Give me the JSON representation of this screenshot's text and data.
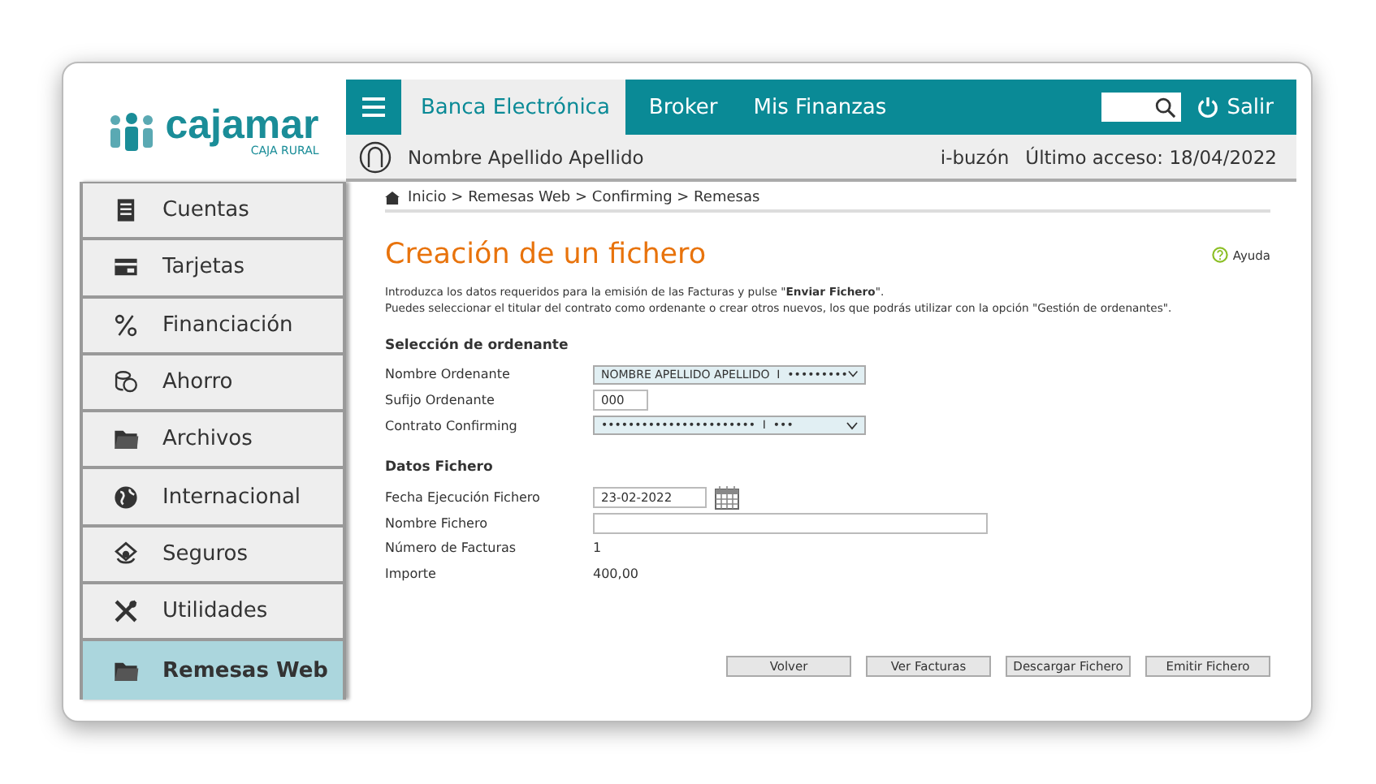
{
  "logo": {
    "name": "cajamar",
    "tagline": "CAJA RURAL"
  },
  "nav": {
    "tabs": [
      {
        "label": "Banca Electrónica",
        "selected": true
      },
      {
        "label": "Broker",
        "selected": false
      },
      {
        "label": "Mis Finanzas",
        "selected": false
      }
    ],
    "logout": "Salir"
  },
  "user": {
    "name": "Nombre Apellido Apellido",
    "mailbox": "i-buzón",
    "last_access": "Último acceso: 18/04/2022"
  },
  "sidebar": {
    "items": [
      {
        "label": "Cuentas",
        "selected": false
      },
      {
        "label": "Tarjetas",
        "selected": false
      },
      {
        "label": "Financiación",
        "selected": false
      },
      {
        "label": "Ahorro",
        "selected": false
      },
      {
        "label": "Archivos",
        "selected": false
      },
      {
        "label": "Internacional",
        "selected": false
      },
      {
        "label": "Seguros",
        "selected": false
      },
      {
        "label": "Utilidades",
        "selected": false
      },
      {
        "label": "Remesas Web",
        "selected": true
      }
    ]
  },
  "breadcrumb": "Inicio > Remesas Web > Confirming > Remesas",
  "page": {
    "title": "Creación de un fichero",
    "help": "Ayuda",
    "intro": [
      "Introduzca los datos requeridos para la emisión de las Facturas y pulse \"**Enviar Fichero**\".",
      "Puedes seleccionar el titular del contrato como ordenante o crear otros nuevos, los que podrás utilizar con la opción \"Gestión de ordenantes\"."
    ]
  },
  "sections": [
    {
      "title": "Selección de ordenante",
      "fields": [
        {
          "label": "Nombre Ordenante",
          "kind": "select",
          "value": "NOMBRE APELLIDO APELLIDO  I  •••••••••"
        },
        {
          "label": "Sufijo Ordenante",
          "kind": "short",
          "value": "000"
        },
        {
          "label": "Contrato Confirming",
          "kind": "select",
          "value": "•••••••••••••••••••••••  I  •••"
        }
      ]
    },
    {
      "title": "Datos Fichero",
      "fields": [
        {
          "label": "Fecha Ejecución Fichero",
          "kind": "date",
          "value": "23-02-2022"
        },
        {
          "label": "Nombre Fichero",
          "kind": "wide"
        },
        {
          "label": "Número de Facturas",
          "kind": "text",
          "value": "1"
        },
        {
          "label": "Importe",
          "kind": "text",
          "value": "400,00"
        }
      ]
    }
  ],
  "buttons": [
    "Volver",
    "Ver Facturas",
    "Descargar Fichero",
    "Emitir Fichero"
  ]
}
